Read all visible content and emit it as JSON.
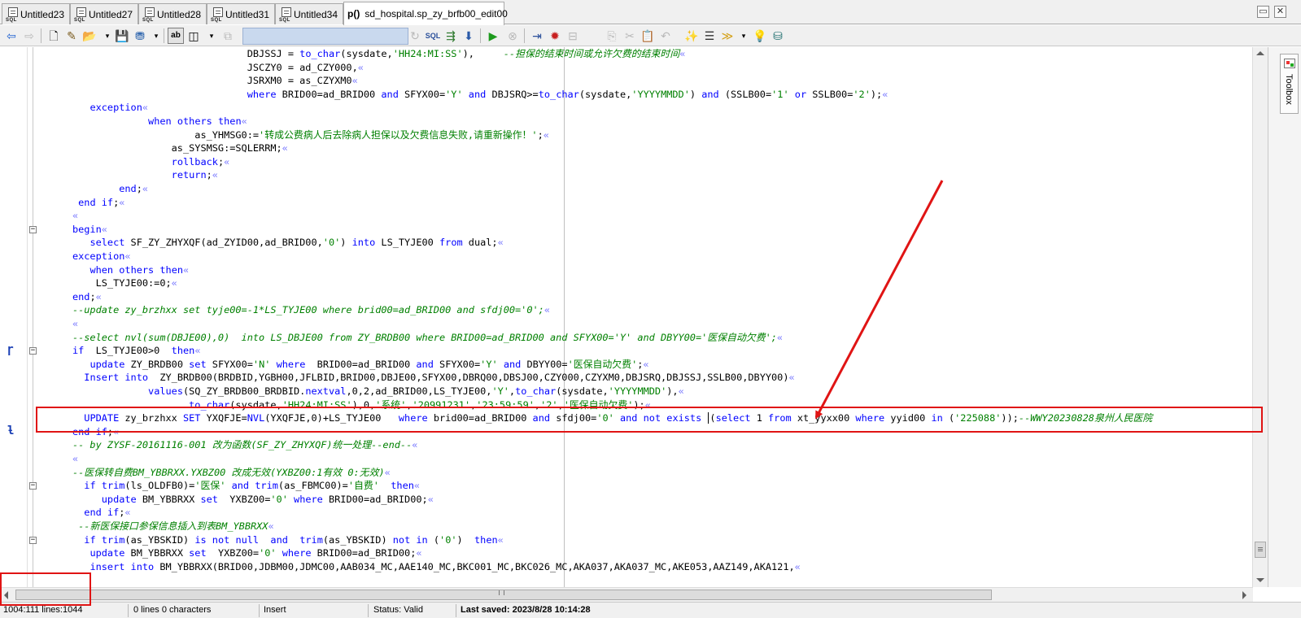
{
  "tabs": [
    {
      "label": "Untitled23",
      "icon": "sql-file-icon",
      "icon_text": "SQL"
    },
    {
      "label": "Untitled27",
      "icon": "sql-file-icon",
      "icon_text": "SQL"
    },
    {
      "label": "Untitled28",
      "icon": "sql-file-icon",
      "icon_text": "SQL"
    },
    {
      "label": "Untitled31",
      "icon": "sql-file-icon",
      "icon_text": "SQL"
    },
    {
      "label": "Untitled34",
      "icon": "sql-file-icon",
      "icon_text": "SQL"
    },
    {
      "label": "sd_hospital.sp_zy_brfb00_edit00",
      "icon": "procedure-icon",
      "icon_text": "p()",
      "active": true
    }
  ],
  "window_buttons": {
    "restore": "restore-icon",
    "close": "close-icon"
  },
  "toolbox": {
    "label": "Toolbox",
    "icon": "toolbox-icon"
  },
  "status": {
    "position": "1004:111 lines:1044",
    "selection": "0 lines 0 characters",
    "mode": "Insert",
    "state": "Status: Valid",
    "saved": "Last saved: 2023/8/28 10:14:28"
  },
  "colors": {
    "keyword": "#0000ff",
    "string": "#008000",
    "comment": "#008000",
    "annotation": "#e01414"
  },
  "code_lines": [
    [
      [
        "n",
        "                                    DBJSSJ = "
      ],
      [
        "k",
        "to_char"
      ],
      [
        "n",
        "(sysdate,"
      ],
      [
        "s",
        "'HH24:MI:SS'"
      ],
      [
        "n",
        "),     "
      ],
      [
        "c",
        "--担保的结束时间或允许欠费的结束时间"
      ],
      [
        "p",
        "«"
      ]
    ],
    [
      [
        "n",
        "                                    JSCZY0 = ad_CZY000,"
      ],
      [
        "p",
        "«"
      ]
    ],
    [
      [
        "n",
        "                                    JSRXM0 = as_CZYXM0"
      ],
      [
        "p",
        "«"
      ]
    ],
    [
      [
        "n",
        "                                    "
      ],
      [
        "k",
        "where"
      ],
      [
        "n",
        " BRID00=ad_BRID00 "
      ],
      [
        "k",
        "and"
      ],
      [
        "n",
        " SFYX00="
      ],
      [
        "s",
        "'Y'"
      ],
      [
        "n",
        " "
      ],
      [
        "k",
        "and"
      ],
      [
        "n",
        " DBJSRQ>="
      ],
      [
        "k",
        "to_char"
      ],
      [
        "n",
        "(sysdate,"
      ],
      [
        "s",
        "'YYYYMMDD'"
      ],
      [
        "n",
        ") "
      ],
      [
        "k",
        "and"
      ],
      [
        "n",
        " (SSLB00="
      ],
      [
        "s",
        "'1'"
      ],
      [
        "n",
        " "
      ],
      [
        "k",
        "or"
      ],
      [
        "n",
        " SSLB00="
      ],
      [
        "s",
        "'2'"
      ],
      [
        "n",
        ");"
      ],
      [
        "p",
        "«"
      ]
    ],
    [
      [
        "n",
        "         "
      ],
      [
        "k",
        "exception"
      ],
      [
        "p",
        "«"
      ]
    ],
    [
      [
        "n",
        "                   "
      ],
      [
        "k",
        "when"
      ],
      [
        "n",
        " "
      ],
      [
        "k",
        "others"
      ],
      [
        "n",
        " "
      ],
      [
        "k",
        "then"
      ],
      [
        "p",
        "«"
      ]
    ],
    [
      [
        "n",
        "                           as_YHMSG0:="
      ],
      [
        "s",
        "'转成公费病人后去除病人担保以及欠费信息失败,请重新操作！'"
      ],
      [
        "n",
        ";"
      ],
      [
        "p",
        "«"
      ]
    ],
    [
      [
        "n",
        "                       as_SYSMSG:=SQLERRM;"
      ],
      [
        "p",
        "«"
      ]
    ],
    [
      [
        "n",
        "                       "
      ],
      [
        "k",
        "rollback"
      ],
      [
        "n",
        ";"
      ],
      [
        "p",
        "«"
      ]
    ],
    [
      [
        "n",
        "                       "
      ],
      [
        "k",
        "return"
      ],
      [
        "n",
        ";"
      ],
      [
        "p",
        "«"
      ]
    ],
    [
      [
        "n",
        "              "
      ],
      [
        "k",
        "end"
      ],
      [
        "n",
        ";"
      ],
      [
        "p",
        "«"
      ]
    ],
    [
      [
        "n",
        "       "
      ],
      [
        "k",
        "end if"
      ],
      [
        "n",
        ";"
      ],
      [
        "p",
        "«"
      ]
    ],
    [
      [
        "p",
        "      «"
      ]
    ],
    [
      [
        "n",
        "      "
      ],
      [
        "k",
        "begin"
      ],
      [
        "p",
        "«"
      ]
    ],
    [
      [
        "n",
        "         "
      ],
      [
        "k",
        "select"
      ],
      [
        "n",
        " SF_ZY_ZHYXQF(ad_ZYID00,ad_BRID00,"
      ],
      [
        "s",
        "'0'"
      ],
      [
        "n",
        ") "
      ],
      [
        "k",
        "into"
      ],
      [
        "n",
        " LS_TYJE00 "
      ],
      [
        "k",
        "from"
      ],
      [
        "n",
        " dual;"
      ],
      [
        "p",
        "«"
      ]
    ],
    [
      [
        "n",
        "      "
      ],
      [
        "k",
        "exception"
      ],
      [
        "p",
        "«"
      ]
    ],
    [
      [
        "n",
        "         "
      ],
      [
        "k",
        "when"
      ],
      [
        "n",
        " "
      ],
      [
        "k",
        "others"
      ],
      [
        "n",
        " "
      ],
      [
        "k",
        "then"
      ],
      [
        "p",
        "«"
      ]
    ],
    [
      [
        "n",
        "          LS_TYJE00:=0;"
      ],
      [
        "p",
        "«"
      ]
    ],
    [
      [
        "n",
        "      "
      ],
      [
        "k",
        "end"
      ],
      [
        "n",
        ";"
      ],
      [
        "p",
        "«"
      ]
    ],
    [
      [
        "n",
        "      "
      ],
      [
        "c",
        "--update zy_brzhxx set tyje00=-1*LS_TYJE00 where brid00=ad_BRID00 and sfdj00='0';"
      ],
      [
        "p",
        "«"
      ]
    ],
    [
      [
        "p",
        "      «"
      ]
    ],
    [
      [
        "n",
        "      "
      ],
      [
        "c",
        "--select nvl(sum(DBJE00),0)  into LS_DBJE00 from ZY_BRDB00 where BRID00=ad_BRID00 and SFYX00='Y' and DBYY00='医保自动欠费';"
      ],
      [
        "p",
        "«"
      ]
    ],
    [
      [
        "n",
        "      "
      ],
      [
        "k",
        "if"
      ],
      [
        "n",
        "  LS_TYJE00>0  "
      ],
      [
        "k",
        "then"
      ],
      [
        "p",
        "«"
      ]
    ],
    [
      [
        "n",
        "         "
      ],
      [
        "k",
        "update"
      ],
      [
        "n",
        " ZY_BRDB00 "
      ],
      [
        "k",
        "set"
      ],
      [
        "n",
        " SFYX00="
      ],
      [
        "s",
        "'N'"
      ],
      [
        "n",
        " "
      ],
      [
        "k",
        "where"
      ],
      [
        "n",
        "  BRID00=ad_BRID00 "
      ],
      [
        "k",
        "and"
      ],
      [
        "n",
        " SFYX00="
      ],
      [
        "s",
        "'Y'"
      ],
      [
        "n",
        " "
      ],
      [
        "k",
        "and"
      ],
      [
        "n",
        " DBYY00="
      ],
      [
        "s",
        "'医保自动欠费'"
      ],
      [
        "n",
        ";"
      ],
      [
        "p",
        "«"
      ]
    ],
    [
      [
        "n",
        "        "
      ],
      [
        "k",
        "Insert into"
      ],
      [
        "n",
        "  ZY_BRDB00(BRDBID,YGBH00,JFLBID,BRID00,DBJE00,SFYX00,DBRQ00,DBSJ00,CZY000,CZYXM0,DBJSRQ,DBJSSJ,SSLB00,DBYY00)"
      ],
      [
        "p",
        "«"
      ]
    ],
    [
      [
        "n",
        "                   "
      ],
      [
        "k",
        "values"
      ],
      [
        "n",
        "(SQ_ZY_BRDB00_BRDBID."
      ],
      [
        "k",
        "nextval"
      ],
      [
        "n",
        ",0,2,ad_BRID00,LS_TYJE00,"
      ],
      [
        "s",
        "'Y'"
      ],
      [
        "n",
        ","
      ],
      [
        "k",
        "to_char"
      ],
      [
        "n",
        "(sysdate,"
      ],
      [
        "s",
        "'YYYYMMDD'"
      ],
      [
        "n",
        "),"
      ],
      [
        "p",
        "«"
      ]
    ],
    [
      [
        "n",
        "                          "
      ],
      [
        "k",
        "to_char"
      ],
      [
        "n",
        "(sysdate,"
      ],
      [
        "s",
        "'HH24:MI:SS'"
      ],
      [
        "n",
        "),0,"
      ],
      [
        "s",
        "'系统'"
      ],
      [
        "n",
        ","
      ],
      [
        "s",
        "'20991231'"
      ],
      [
        "n",
        ","
      ],
      [
        "s",
        "'23:59:59'"
      ],
      [
        "n",
        ","
      ],
      [
        "s",
        "'2'"
      ],
      [
        "n",
        ","
      ],
      [
        "s",
        "'医保自动欠费'"
      ],
      [
        "n",
        ");"
      ],
      [
        "p",
        "«"
      ]
    ],
    [
      [
        "n",
        "        "
      ],
      [
        "k",
        "UPDATE"
      ],
      [
        "n",
        " zy_brzhxx "
      ],
      [
        "k",
        "SET"
      ],
      [
        "n",
        " YXQFJE="
      ],
      [
        "k",
        "NVL"
      ],
      [
        "n",
        "(YXQFJE,0)+LS_TYJE00   "
      ],
      [
        "k",
        "where"
      ],
      [
        "n",
        " brid00=ad_BRID00 "
      ],
      [
        "k",
        "and"
      ],
      [
        "n",
        " sfdj00="
      ],
      [
        "s",
        "'0'"
      ],
      [
        "n",
        " "
      ],
      [
        "k",
        "and"
      ],
      [
        "n",
        " "
      ],
      [
        "k",
        "not"
      ],
      [
        "n",
        " "
      ],
      [
        "k",
        "exists"
      ],
      [
        "n",
        " "
      ],
      [
        "caret",
        ""
      ],
      [
        "n",
        "("
      ],
      [
        "k",
        "select"
      ],
      [
        "n",
        " 1 "
      ],
      [
        "k",
        "from"
      ],
      [
        "n",
        " xt_yyxx00 "
      ],
      [
        "k",
        "where"
      ],
      [
        "n",
        " yyid00 "
      ],
      [
        "k",
        "in"
      ],
      [
        "n",
        " ("
      ],
      [
        "s",
        "'225088'"
      ],
      [
        "n",
        "));"
      ],
      [
        "c",
        "--WWY20230828泉州人民医院"
      ]
    ],
    [
      [
        "n",
        "      "
      ],
      [
        "k",
        "end if"
      ],
      [
        "n",
        ";"
      ],
      [
        "p",
        "«"
      ]
    ],
    [
      [
        "n",
        "      "
      ],
      [
        "c",
        "-- by ZYSF-20161116-001 改为函数(SF_ZY_ZHYXQF)统一处理--end--"
      ],
      [
        "p",
        "«"
      ]
    ],
    [
      [
        "p",
        "      «"
      ]
    ],
    [
      [
        "n",
        "      "
      ],
      [
        "c",
        "--医保转自费BM_YBBRXX.YXBZ00 改成无效(YXBZ00:1有效 0:无效)"
      ],
      [
        "p",
        "«"
      ]
    ],
    [
      [
        "n",
        "        "
      ],
      [
        "k",
        "if"
      ],
      [
        "n",
        " "
      ],
      [
        "k",
        "trim"
      ],
      [
        "n",
        "(ls_OLDFB0)="
      ],
      [
        "s",
        "'医保'"
      ],
      [
        "n",
        " "
      ],
      [
        "k",
        "and"
      ],
      [
        "n",
        " "
      ],
      [
        "k",
        "trim"
      ],
      [
        "n",
        "(as_FBMC00)="
      ],
      [
        "s",
        "'自费'"
      ],
      [
        "n",
        "  "
      ],
      [
        "k",
        "then"
      ],
      [
        "p",
        "«"
      ]
    ],
    [
      [
        "n",
        "           "
      ],
      [
        "k",
        "update"
      ],
      [
        "n",
        " BM_YBBRXX "
      ],
      [
        "k",
        "set"
      ],
      [
        "n",
        "  YXBZ00="
      ],
      [
        "s",
        "'0'"
      ],
      [
        "n",
        " "
      ],
      [
        "k",
        "where"
      ],
      [
        "n",
        " BRID00=ad_BRID00;"
      ],
      [
        "p",
        "«"
      ]
    ],
    [
      [
        "n",
        "        "
      ],
      [
        "k",
        "end if"
      ],
      [
        "n",
        ";"
      ],
      [
        "p",
        "«"
      ]
    ],
    [
      [
        "n",
        "       "
      ],
      [
        "c",
        "--新医保接口参保信息插入到表BM_YBBRXX"
      ],
      [
        "p",
        "«"
      ]
    ],
    [
      [
        "n",
        "        "
      ],
      [
        "k",
        "if"
      ],
      [
        "n",
        " "
      ],
      [
        "k",
        "trim"
      ],
      [
        "n",
        "(as_YBSKID) "
      ],
      [
        "k",
        "is not null"
      ],
      [
        "n",
        "  "
      ],
      [
        "k",
        "and"
      ],
      [
        "n",
        "  "
      ],
      [
        "k",
        "trim"
      ],
      [
        "n",
        "(as_YBSKID) "
      ],
      [
        "k",
        "not in"
      ],
      [
        "n",
        " ("
      ],
      [
        "s",
        "'0'"
      ],
      [
        "n",
        ")  "
      ],
      [
        "k",
        "then"
      ],
      [
        "p",
        "«"
      ]
    ],
    [
      [
        "n",
        "         "
      ],
      [
        "k",
        "update"
      ],
      [
        "n",
        " BM_YBBRXX "
      ],
      [
        "k",
        "set"
      ],
      [
        "n",
        "  YXBZ00="
      ],
      [
        "s",
        "'0'"
      ],
      [
        "n",
        " "
      ],
      [
        "k",
        "where"
      ],
      [
        "n",
        " BRID00=ad_BRID00;"
      ],
      [
        "p",
        "«"
      ]
    ],
    [
      [
        "n",
        "         "
      ],
      [
        "k",
        "insert into"
      ],
      [
        "n",
        " BM_YBBRXX(BRID00,JDBM00,JDMC00,AAB034_MC,AAE140_MC,BKC001_MC,BKC026_MC,AKA037,AKA037_MC,AKE053,AAZ149,AKA121,"
      ],
      [
        "p",
        "«"
      ]
    ]
  ],
  "gutter_markers": [
    {
      "line": 22,
      "symbol": "ɼ"
    },
    {
      "line": 28,
      "symbol": "ƚ"
    }
  ],
  "fold_markers": [
    13,
    22,
    32,
    36
  ]
}
